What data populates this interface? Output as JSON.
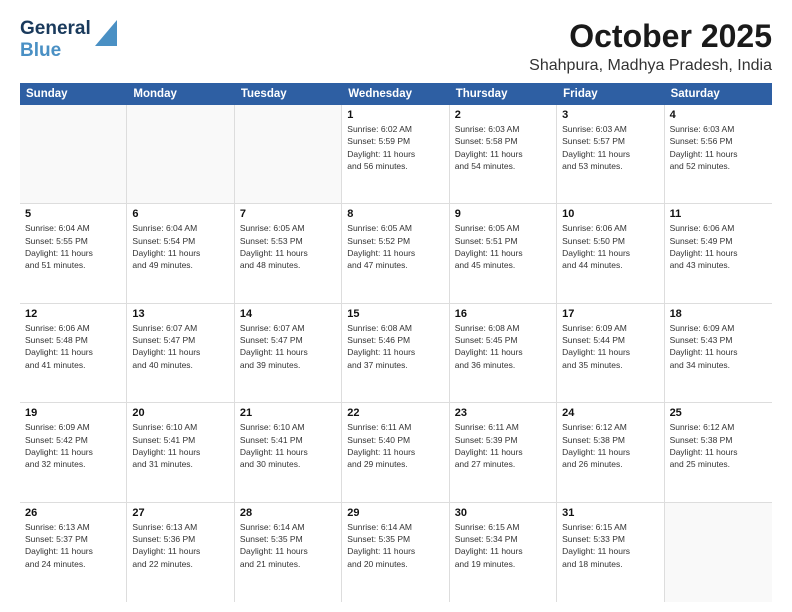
{
  "logo": {
    "line1": "General",
    "line2": "Blue"
  },
  "title": "October 2025",
  "subtitle": "Shahpura, Madhya Pradesh, India",
  "days": [
    "Sunday",
    "Monday",
    "Tuesday",
    "Wednesday",
    "Thursday",
    "Friday",
    "Saturday"
  ],
  "weeks": [
    [
      {
        "day": "",
        "info": ""
      },
      {
        "day": "",
        "info": ""
      },
      {
        "day": "",
        "info": ""
      },
      {
        "day": "1",
        "info": "Sunrise: 6:02 AM\nSunset: 5:59 PM\nDaylight: 11 hours\nand 56 minutes."
      },
      {
        "day": "2",
        "info": "Sunrise: 6:03 AM\nSunset: 5:58 PM\nDaylight: 11 hours\nand 54 minutes."
      },
      {
        "day": "3",
        "info": "Sunrise: 6:03 AM\nSunset: 5:57 PM\nDaylight: 11 hours\nand 53 minutes."
      },
      {
        "day": "4",
        "info": "Sunrise: 6:03 AM\nSunset: 5:56 PM\nDaylight: 11 hours\nand 52 minutes."
      }
    ],
    [
      {
        "day": "5",
        "info": "Sunrise: 6:04 AM\nSunset: 5:55 PM\nDaylight: 11 hours\nand 51 minutes."
      },
      {
        "day": "6",
        "info": "Sunrise: 6:04 AM\nSunset: 5:54 PM\nDaylight: 11 hours\nand 49 minutes."
      },
      {
        "day": "7",
        "info": "Sunrise: 6:05 AM\nSunset: 5:53 PM\nDaylight: 11 hours\nand 48 minutes."
      },
      {
        "day": "8",
        "info": "Sunrise: 6:05 AM\nSunset: 5:52 PM\nDaylight: 11 hours\nand 47 minutes."
      },
      {
        "day": "9",
        "info": "Sunrise: 6:05 AM\nSunset: 5:51 PM\nDaylight: 11 hours\nand 45 minutes."
      },
      {
        "day": "10",
        "info": "Sunrise: 6:06 AM\nSunset: 5:50 PM\nDaylight: 11 hours\nand 44 minutes."
      },
      {
        "day": "11",
        "info": "Sunrise: 6:06 AM\nSunset: 5:49 PM\nDaylight: 11 hours\nand 43 minutes."
      }
    ],
    [
      {
        "day": "12",
        "info": "Sunrise: 6:06 AM\nSunset: 5:48 PM\nDaylight: 11 hours\nand 41 minutes."
      },
      {
        "day": "13",
        "info": "Sunrise: 6:07 AM\nSunset: 5:47 PM\nDaylight: 11 hours\nand 40 minutes."
      },
      {
        "day": "14",
        "info": "Sunrise: 6:07 AM\nSunset: 5:47 PM\nDaylight: 11 hours\nand 39 minutes."
      },
      {
        "day": "15",
        "info": "Sunrise: 6:08 AM\nSunset: 5:46 PM\nDaylight: 11 hours\nand 37 minutes."
      },
      {
        "day": "16",
        "info": "Sunrise: 6:08 AM\nSunset: 5:45 PM\nDaylight: 11 hours\nand 36 minutes."
      },
      {
        "day": "17",
        "info": "Sunrise: 6:09 AM\nSunset: 5:44 PM\nDaylight: 11 hours\nand 35 minutes."
      },
      {
        "day": "18",
        "info": "Sunrise: 6:09 AM\nSunset: 5:43 PM\nDaylight: 11 hours\nand 34 minutes."
      }
    ],
    [
      {
        "day": "19",
        "info": "Sunrise: 6:09 AM\nSunset: 5:42 PM\nDaylight: 11 hours\nand 32 minutes."
      },
      {
        "day": "20",
        "info": "Sunrise: 6:10 AM\nSunset: 5:41 PM\nDaylight: 11 hours\nand 31 minutes."
      },
      {
        "day": "21",
        "info": "Sunrise: 6:10 AM\nSunset: 5:41 PM\nDaylight: 11 hours\nand 30 minutes."
      },
      {
        "day": "22",
        "info": "Sunrise: 6:11 AM\nSunset: 5:40 PM\nDaylight: 11 hours\nand 29 minutes."
      },
      {
        "day": "23",
        "info": "Sunrise: 6:11 AM\nSunset: 5:39 PM\nDaylight: 11 hours\nand 27 minutes."
      },
      {
        "day": "24",
        "info": "Sunrise: 6:12 AM\nSunset: 5:38 PM\nDaylight: 11 hours\nand 26 minutes."
      },
      {
        "day": "25",
        "info": "Sunrise: 6:12 AM\nSunset: 5:38 PM\nDaylight: 11 hours\nand 25 minutes."
      }
    ],
    [
      {
        "day": "26",
        "info": "Sunrise: 6:13 AM\nSunset: 5:37 PM\nDaylight: 11 hours\nand 24 minutes."
      },
      {
        "day": "27",
        "info": "Sunrise: 6:13 AM\nSunset: 5:36 PM\nDaylight: 11 hours\nand 22 minutes."
      },
      {
        "day": "28",
        "info": "Sunrise: 6:14 AM\nSunset: 5:35 PM\nDaylight: 11 hours\nand 21 minutes."
      },
      {
        "day": "29",
        "info": "Sunrise: 6:14 AM\nSunset: 5:35 PM\nDaylight: 11 hours\nand 20 minutes."
      },
      {
        "day": "30",
        "info": "Sunrise: 6:15 AM\nSunset: 5:34 PM\nDaylight: 11 hours\nand 19 minutes."
      },
      {
        "day": "31",
        "info": "Sunrise: 6:15 AM\nSunset: 5:33 PM\nDaylight: 11 hours\nand 18 minutes."
      },
      {
        "day": "",
        "info": ""
      }
    ]
  ]
}
